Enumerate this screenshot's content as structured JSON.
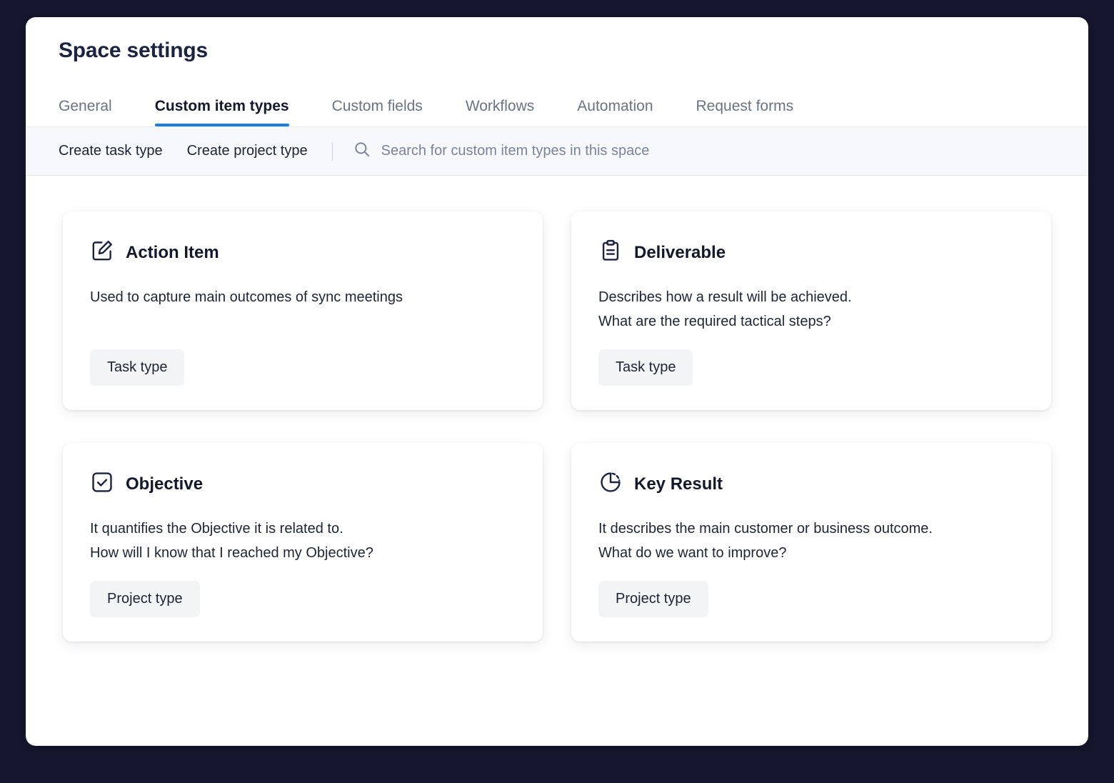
{
  "header": {
    "title": "Space settings"
  },
  "colors": {
    "accent": "#1a7ee0",
    "title": "#1c2340",
    "toolbar_bg": "#f7f8fb",
    "chip_bg": "#f3f4f6",
    "backdrop": "#16162e"
  },
  "tabs": [
    {
      "label": "General",
      "active": false
    },
    {
      "label": "Custom item types",
      "active": true
    },
    {
      "label": "Custom fields",
      "active": false
    },
    {
      "label": "Workflows",
      "active": false
    },
    {
      "label": "Automation",
      "active": false
    },
    {
      "label": "Request forms",
      "active": false
    }
  ],
  "toolbar": {
    "create_task_type": "Create task type",
    "create_project_type": "Create project type",
    "search_icon": "search-icon",
    "search_placeholder": "Search for custom item types in this space",
    "search_value": ""
  },
  "cards": [
    {
      "title": "Action Item",
      "icon": "edit-square-icon",
      "desc_lines": [
        "Used to capture main outcomes of sync meetings"
      ],
      "chip": "Task type"
    },
    {
      "title": "Deliverable",
      "icon": "clipboard-icon",
      "desc_lines": [
        "Describes how a result will be achieved.",
        "What are the required tactical steps?"
      ],
      "chip": "Task type"
    },
    {
      "title": "Objective",
      "icon": "checkbox-check-icon",
      "desc_lines": [
        "It quantifies the Objective it is related to.",
        "How will I know that I reached my Objective?"
      ],
      "chip": "Project type"
    },
    {
      "title": "Key Result",
      "icon": "pie-chart-icon",
      "desc_lines": [
        "It describes the main customer or business outcome.",
        "What do we want to improve?"
      ],
      "chip": "Project type"
    }
  ]
}
